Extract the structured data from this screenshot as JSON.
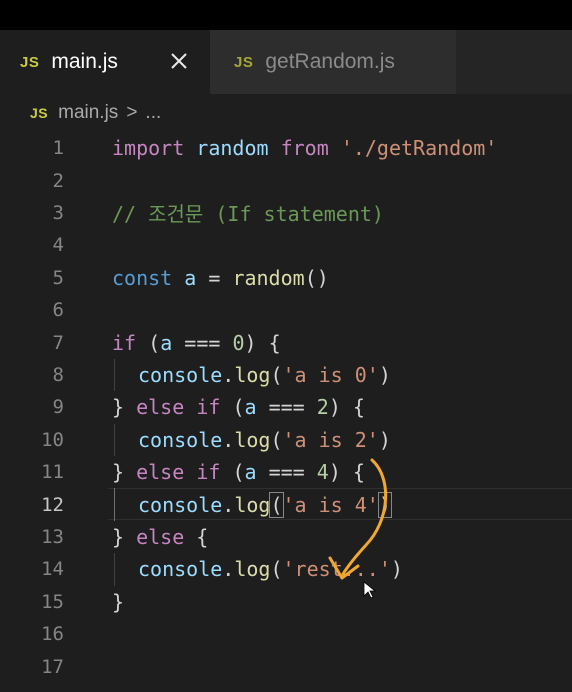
{
  "tabs": [
    {
      "icon": "JS",
      "label": "main.js",
      "active": true,
      "close": "✕"
    },
    {
      "icon": "JS",
      "label": "getRandom.js",
      "active": false
    }
  ],
  "breadcrumb": {
    "icon": "JS",
    "file": "main.js",
    "separator": ">",
    "more": "..."
  },
  "editor": {
    "current_line": 12,
    "lines": [
      {
        "n": "1"
      },
      {
        "n": "2"
      },
      {
        "n": "3"
      },
      {
        "n": "4"
      },
      {
        "n": "5"
      },
      {
        "n": "6"
      },
      {
        "n": "7"
      },
      {
        "n": "8"
      },
      {
        "n": "9"
      },
      {
        "n": "10"
      },
      {
        "n": "11"
      },
      {
        "n": "12"
      },
      {
        "n": "13"
      },
      {
        "n": "14"
      },
      {
        "n": "15"
      },
      {
        "n": "16"
      },
      {
        "n": "17"
      }
    ],
    "tokens": {
      "l1": [
        "import",
        " ",
        "random",
        " ",
        "from",
        " ",
        "'./getRandom'"
      ],
      "l3": "// 조건문 (If statement)",
      "l5": [
        "const",
        " ",
        "a",
        " = ",
        "random",
        "()"
      ],
      "l7": [
        "if",
        " (",
        "a",
        " === ",
        "0",
        ") {"
      ],
      "l8": [
        "console",
        ".",
        "log",
        "(",
        "'a is 0'",
        ")"
      ],
      "l9": [
        "}",
        " ",
        "else",
        " ",
        "if",
        " (",
        "a",
        " === ",
        "2",
        ") {"
      ],
      "l10": [
        "console",
        ".",
        "log",
        "(",
        "'a is 2'",
        ")"
      ],
      "l11": [
        "}",
        " ",
        "else",
        " ",
        "if",
        " (",
        "a",
        " === ",
        "4",
        ") {"
      ],
      "l12": [
        "console",
        ".",
        "log",
        "(",
        "'a is 4'",
        ")"
      ],
      "l13": [
        "}",
        " ",
        "else",
        " {"
      ],
      "l14": [
        "console",
        ".",
        "log",
        "(",
        "'rest...'",
        ")"
      ],
      "l15": "}"
    }
  },
  "colors": {
    "background": "#1e1e1e",
    "keyword": "#569cd6",
    "control": "#c586c0",
    "variable": "#9cdcfe",
    "function": "#dcdcaa",
    "string": "#ce9178",
    "number": "#b5cea8",
    "comment": "#6a9955",
    "annotation_arrow": "#f0a830"
  }
}
